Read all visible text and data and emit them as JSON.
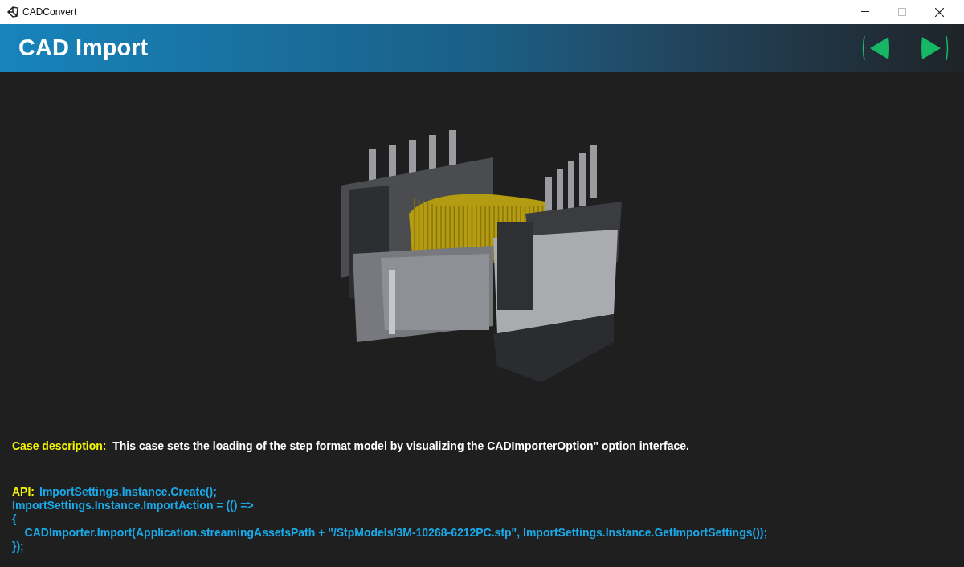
{
  "window": {
    "title": "CADConvert"
  },
  "header": {
    "title": "CAD Import"
  },
  "description": {
    "label": "Case description:",
    "text": "This case sets the loading of the step format model by visualizing the CADImporterOption\" option interface."
  },
  "api": {
    "label": "API:",
    "lines": [
      "ImportSettings.Instance.Create();",
      "ImportSettings.Instance.ImportAction = (() =>",
      "{",
      "    CADImporter.Import(Application.streamingAssetsPath + \"/StpModels/3M-10268-6212PC.stp\", ImportSettings.Instance.GetImportSettings());",
      "});"
    ]
  }
}
